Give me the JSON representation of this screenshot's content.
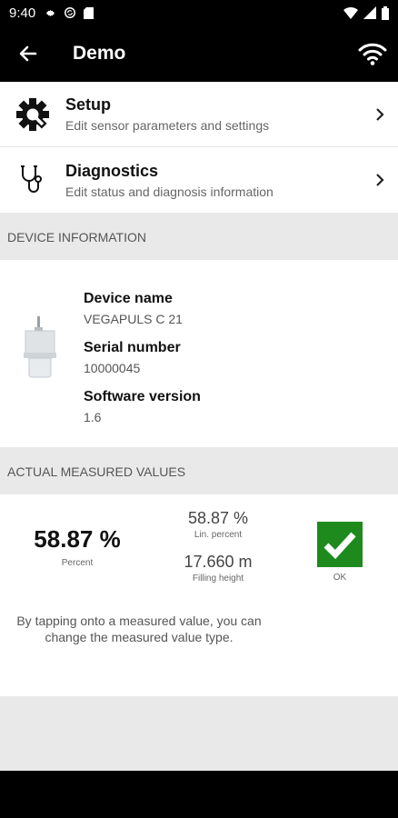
{
  "status_bar": {
    "time": "9:40"
  },
  "app_bar": {
    "title": "Demo"
  },
  "menu": {
    "items": [
      {
        "title": "Setup",
        "subtitle": "Edit sensor parameters  and settings",
        "icon": "gear-icon"
      },
      {
        "title": "Diagnostics",
        "subtitle": "Edit status and diagnosis information",
        "icon": "stethoscope-icon"
      }
    ]
  },
  "device_info": {
    "header": "DEVICE INFORMATION",
    "name_label": "Device name",
    "name_value": "VEGAPULS C 21",
    "serial_label": "Serial number",
    "serial_value": "10000045",
    "software_label": "Software version",
    "software_value": "1.6"
  },
  "measured": {
    "header": "ACTUAL MEASURED VALUES",
    "primary_value": "58.87 %",
    "primary_caption": "Percent",
    "lin_value": "58.87 %",
    "lin_caption": "Lin. percent",
    "height_value": "17.660 m",
    "height_caption": "Filling height",
    "status_caption": "OK",
    "status_color": "#1e8a1e",
    "hint": "By tapping onto a measured value, you can change the measured value type."
  }
}
